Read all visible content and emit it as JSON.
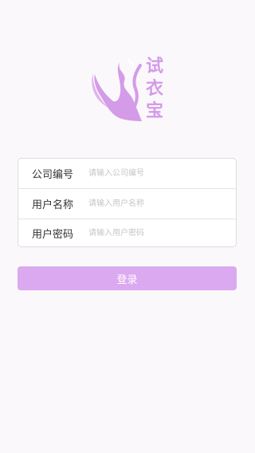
{
  "logo": {
    "text": "试衣宝",
    "chars": [
      "试",
      "衣",
      "宝"
    ],
    "color": "#d49be8"
  },
  "form": {
    "fields": [
      {
        "label": "公司编号",
        "placeholder": "请输入公司编号",
        "value": ""
      },
      {
        "label": "用户名称",
        "placeholder": "请输入用户名称",
        "value": ""
      },
      {
        "label": "用户密码",
        "placeholder": "请输入用户密码",
        "value": ""
      }
    ]
  },
  "login_button": {
    "label": "登录",
    "color": "#dba9f0"
  },
  "theme": {
    "background": "#fbf8fc",
    "accent": "#d49be8"
  }
}
